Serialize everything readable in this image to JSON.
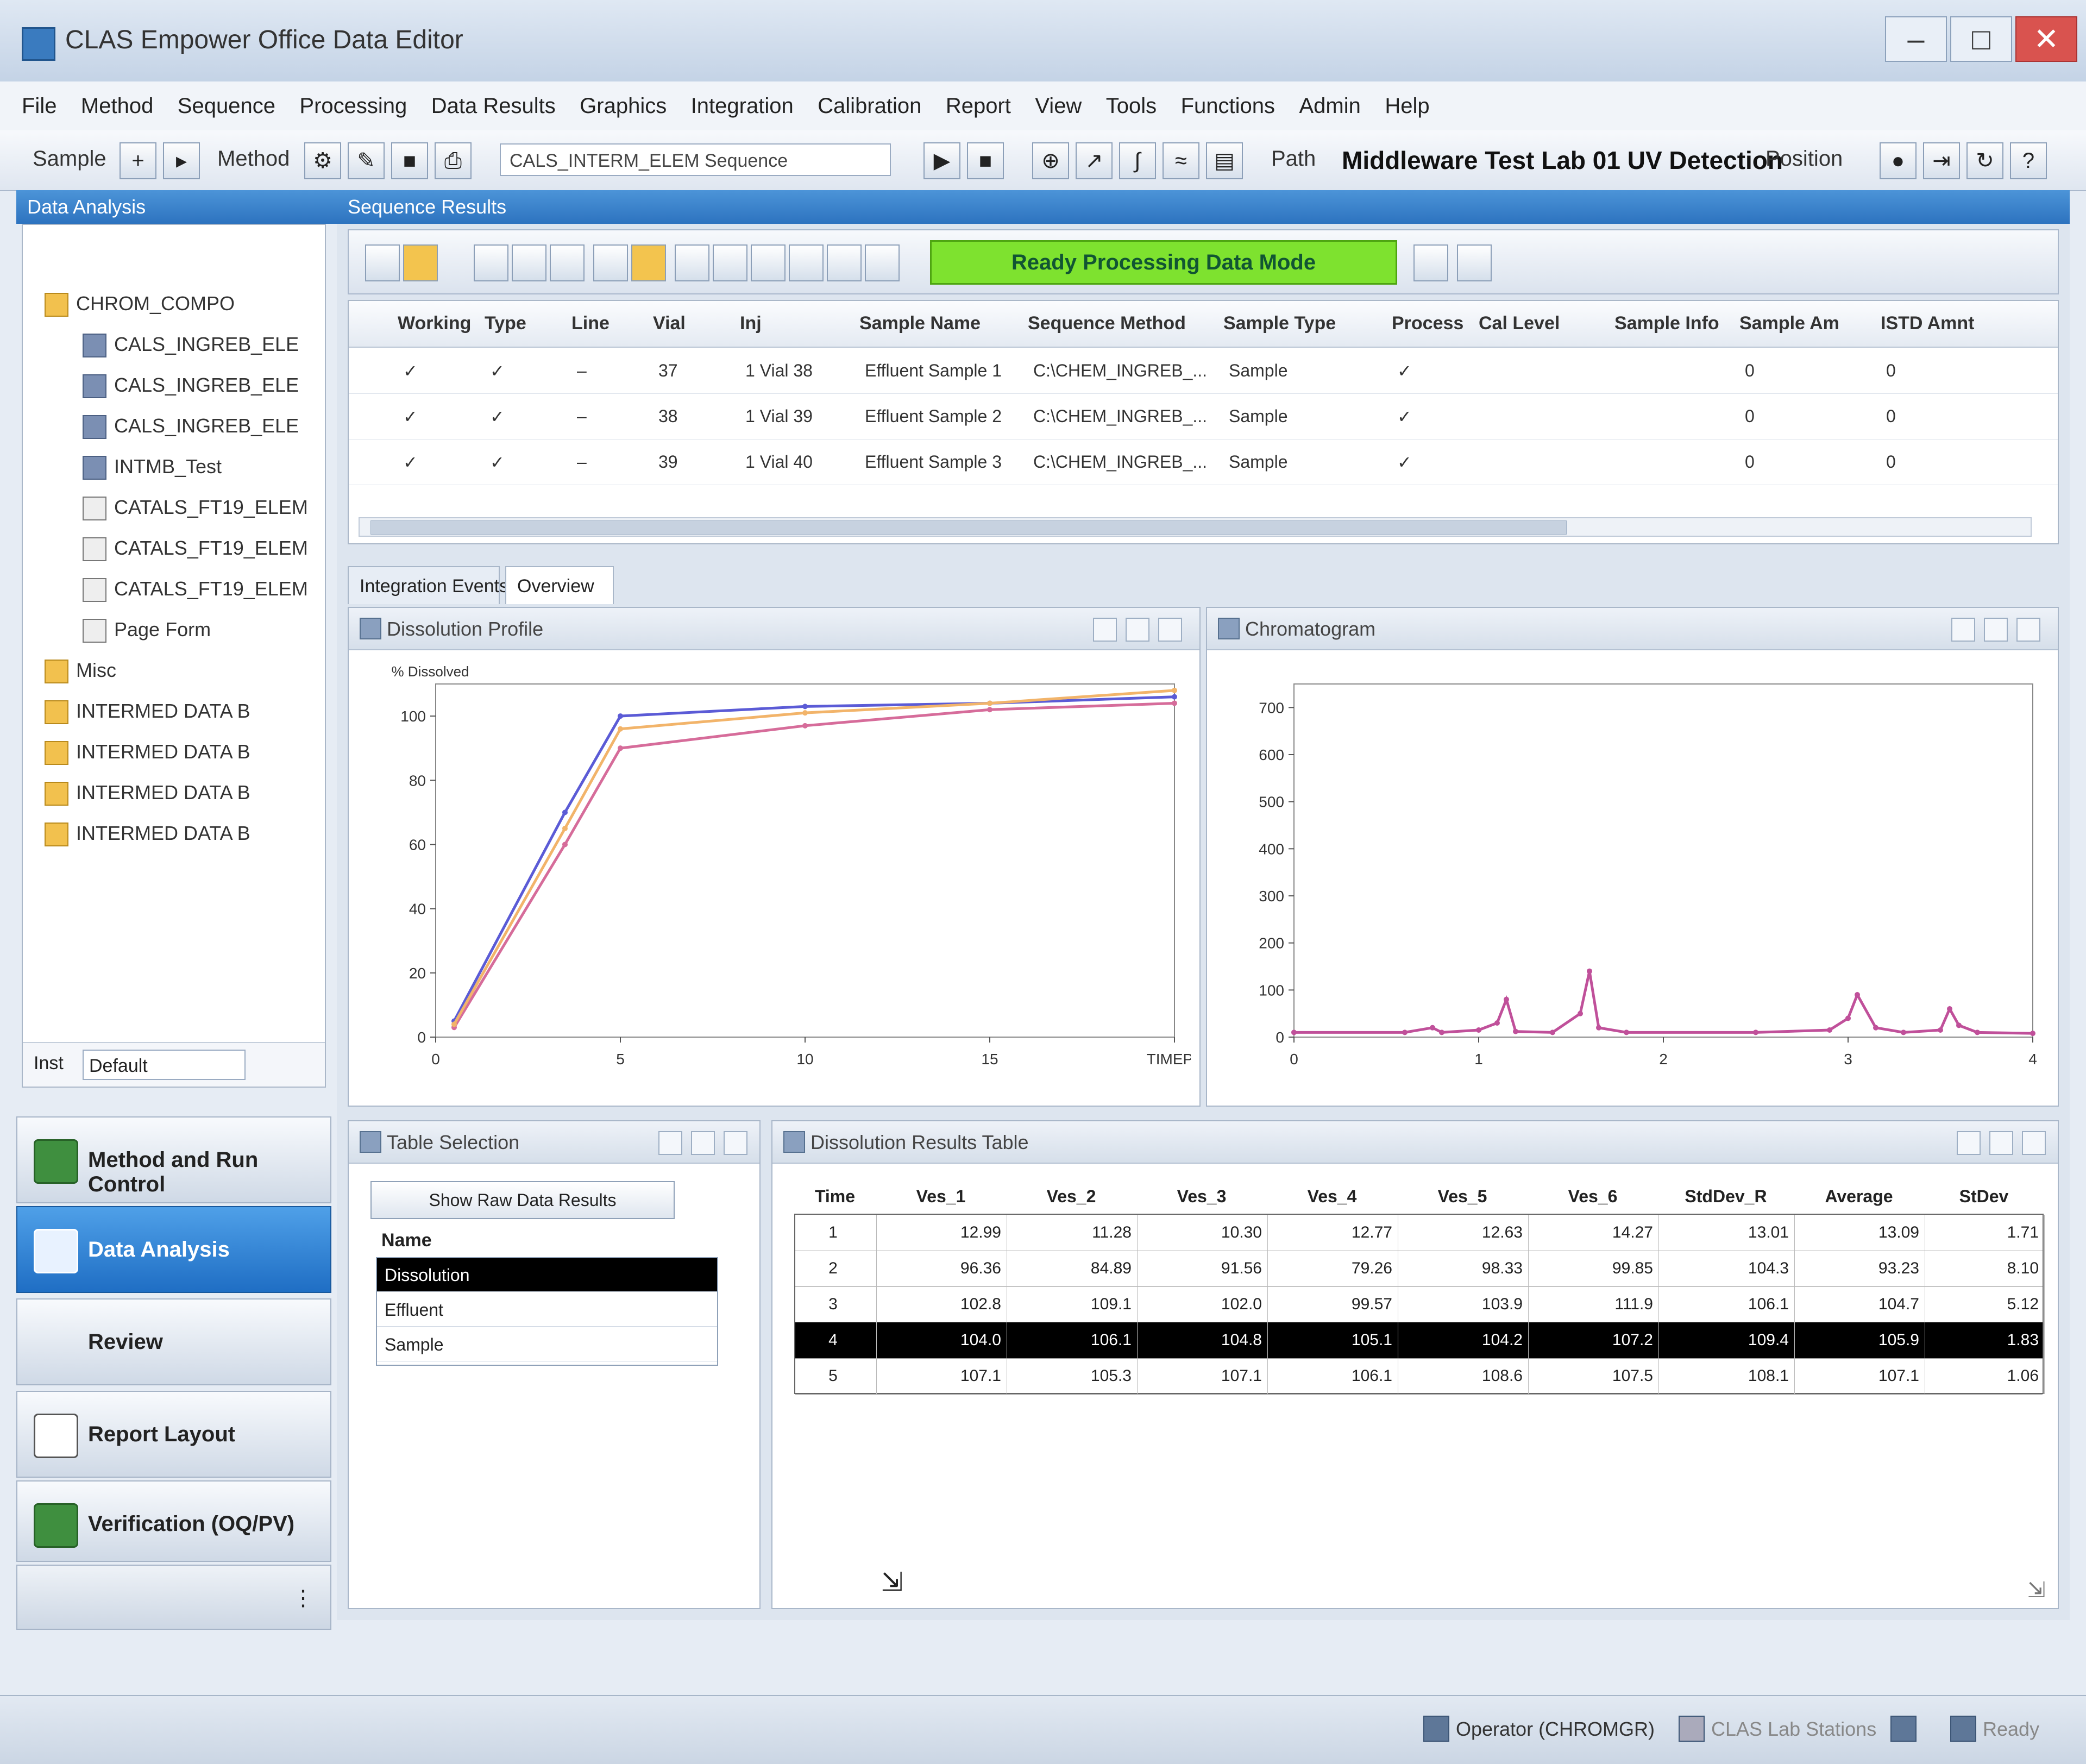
{
  "window": {
    "title": "CLAS Empower Office Data Editor",
    "controls": [
      "–",
      "□",
      "✕"
    ]
  },
  "menu": [
    "File",
    "Method",
    "Sequence",
    "Processing",
    "Data Results",
    "Graphics",
    "Integration",
    "Calibration",
    "Report",
    "View",
    "Tools",
    "Functions",
    "Admin",
    "Help"
  ],
  "toolbar": {
    "sample_label": "Sample",
    "method_label": "Method",
    "sequence_combo": "CALS_INTERM_ELEM Sequence",
    "path_label": "Path",
    "path_value": "Middleware Test Lab 01 UV Detection",
    "position_label": "Position"
  },
  "bluebar": {
    "left": "Data Analysis",
    "right": "Sequence Results"
  },
  "tree": [
    {
      "label": "CHROM_COMPO",
      "icon": "folder",
      "indent": 0
    },
    {
      "label": "CALS_INGREB_ELE",
      "icon": "file",
      "indent": 1
    },
    {
      "label": "CALS_INGREB_ELE",
      "icon": "file",
      "indent": 1
    },
    {
      "label": "CALS_INGREB_ELE",
      "icon": "file",
      "indent": 1
    },
    {
      "label": "INTMB_Test",
      "icon": "file",
      "indent": 1
    },
    {
      "label": "CATALS_FT19_ELEM",
      "icon": "doc",
      "indent": 1
    },
    {
      "label": "CATALS_FT19_ELEM",
      "icon": "doc",
      "indent": 1
    },
    {
      "label": "CATALS_FT19_ELEM",
      "icon": "doc",
      "indent": 1
    },
    {
      "label": "Page Form",
      "icon": "doc",
      "indent": 1
    },
    {
      "label": "Misc",
      "icon": "folder",
      "indent": 0
    },
    {
      "label": "INTERMED DATA B",
      "icon": "folder",
      "indent": 0
    },
    {
      "label": "INTERMED DATA B",
      "icon": "folder",
      "indent": 0
    },
    {
      "label": "INTERMED DATA B",
      "icon": "folder",
      "indent": 0
    },
    {
      "label": "INTERMED DATA B",
      "icon": "folder",
      "indent": 0
    }
  ],
  "filter": {
    "label": "Inst",
    "value": "Default"
  },
  "nav": [
    {
      "label": "Method and Run Control",
      "active": false
    },
    {
      "label": "Data Analysis",
      "active": true
    },
    {
      "label": "Review",
      "active": false
    },
    {
      "label": "Report Layout",
      "active": false
    },
    {
      "label": "Verification (OQ/PV)",
      "active": false
    }
  ],
  "subtoolbar": {
    "status": "Ready Processing Data Mode"
  },
  "sample_grid": {
    "columns": [
      "Working",
      "Type",
      "Line",
      "Vial",
      "Inj",
      "Sample Name",
      "Sequence Method",
      "Sample Type",
      "Process",
      "Cal Level",
      "Sample Info",
      "Sample Am",
      "ISTD Amnt"
    ],
    "rows": [
      [
        "✓",
        "✓",
        "–",
        "37",
        "1 Vial 38",
        "Effluent Sample 1",
        "C:\\CHEM_INGREB_...",
        "Sample",
        "✓",
        "",
        "",
        "0",
        "0"
      ],
      [
        "✓",
        "✓",
        "–",
        "38",
        "1 Vial 39",
        "Effluent Sample 2",
        "C:\\CHEM_INGREB_...",
        "Sample",
        "✓",
        "",
        "",
        "0",
        "0"
      ],
      [
        "✓",
        "✓",
        "–",
        "39",
        "1 Vial 40",
        "Effluent Sample 3",
        "C:\\CHEM_INGREB_...",
        "Sample",
        "✓",
        "",
        "",
        "0",
        "0"
      ]
    ]
  },
  "tabs": [
    "Integration Events",
    "Overview"
  ],
  "panels": {
    "dissolution": "Dissolution Profile",
    "chromatogram": "Chromatogram",
    "table_selection": "Table Selection",
    "results": "Dissolution Results Table"
  },
  "chart_data": [
    {
      "type": "line",
      "title": "",
      "xlabel": "",
      "ylabel": "% Dissolved",
      "x_ticks": [
        "0",
        "5",
        "10",
        "15",
        "TIMEPT"
      ],
      "y_ticks": [
        "0",
        "20",
        "40",
        "60",
        "80",
        "100"
      ],
      "xlim": [
        0,
        20
      ],
      "ylim": [
        0,
        110
      ],
      "series": [
        {
          "color": "#5b5bd6",
          "x": [
            0.5,
            3.5,
            5,
            10,
            15,
            20
          ],
          "y": [
            5,
            70,
            100,
            103,
            104,
            106
          ]
        },
        {
          "color": "#d66c9a",
          "x": [
            0.5,
            3.5,
            5,
            10,
            15,
            20
          ],
          "y": [
            3,
            60,
            90,
            97,
            102,
            104
          ]
        },
        {
          "color": "#f2b46a",
          "x": [
            0.5,
            3.5,
            5,
            10,
            15,
            20
          ],
          "y": [
            4,
            65,
            96,
            101,
            104,
            108
          ]
        }
      ]
    },
    {
      "type": "line",
      "title": "",
      "xlabel": "",
      "ylabel": "",
      "x_ticks": [
        "0",
        "1",
        "2",
        "3",
        "4"
      ],
      "y_ticks": [
        "0",
        "100",
        "200",
        "300",
        "400",
        "500",
        "600",
        "700"
      ],
      "xlim": [
        0,
        4
      ],
      "ylim": [
        0,
        750
      ],
      "series": [
        {
          "color": "#c0509a",
          "x": [
            0,
            0.6,
            0.75,
            0.8,
            1.0,
            1.1,
            1.15,
            1.2,
            1.4,
            1.55,
            1.6,
            1.65,
            1.8,
            2.5,
            2.9,
            3.0,
            3.05,
            3.15,
            3.3,
            3.5,
            3.55,
            3.6,
            3.7,
            4.0
          ],
          "y": [
            10,
            10,
            20,
            10,
            15,
            30,
            80,
            12,
            10,
            50,
            140,
            20,
            10,
            10,
            15,
            40,
            90,
            20,
            10,
            15,
            60,
            25,
            10,
            8
          ]
        }
      ]
    }
  ],
  "table_selection": {
    "button": "Show Raw Data Results",
    "list_header": "Name",
    "items": [
      "Dissolution",
      "Effluent",
      "Sample"
    ],
    "selected": 0
  },
  "results_table": {
    "columns": [
      "Time",
      "Ves_1",
      "Ves_2",
      "Ves_3",
      "Ves_4",
      "Ves_5",
      "Ves_6",
      "StdDev_R",
      "Average",
      "StDev"
    ],
    "rows": [
      [
        "1",
        "12.99",
        "11.28",
        "10.30",
        "12.77",
        "12.63",
        "14.27",
        "13.01",
        "13.09",
        "1.71"
      ],
      [
        "2",
        "96.36",
        "84.89",
        "91.56",
        "79.26",
        "98.33",
        "99.85",
        "104.3",
        "93.23",
        "8.10"
      ],
      [
        "3",
        "102.8",
        "109.1",
        "102.0",
        "99.57",
        "103.9",
        "111.9",
        "106.1",
        "104.7",
        "5.12"
      ],
      [
        "4",
        "104.0",
        "106.1",
        "104.8",
        "105.1",
        "104.2",
        "107.2",
        "109.4",
        "105.9",
        "1.83"
      ],
      [
        "5",
        "107.1",
        "105.3",
        "107.1",
        "106.1",
        "108.6",
        "107.5",
        "108.1",
        "107.1",
        "1.06"
      ]
    ],
    "selected_row": 3
  },
  "statusbar": {
    "user": "Operator (CHROMGR)",
    "lab": "CLAS Lab Stations",
    "mode": "Ready"
  }
}
